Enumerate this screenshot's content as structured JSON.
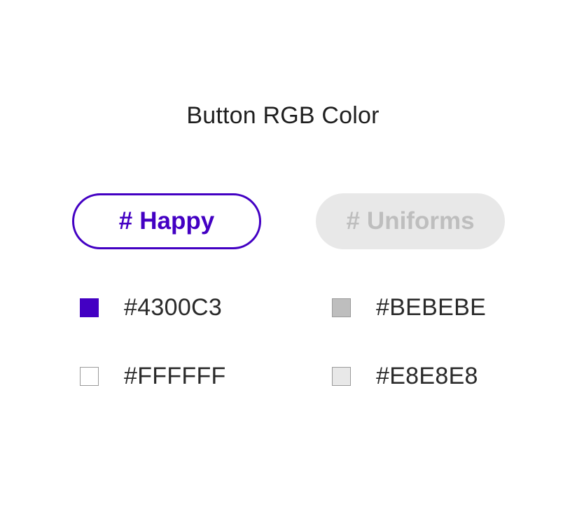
{
  "title": "Button RGB Color",
  "buttons": {
    "happy": {
      "hash": "#",
      "label": "Happy",
      "border_color": "#4300C3",
      "text_color": "#4300C3",
      "bg_color": "#FFFFFF"
    },
    "uniforms": {
      "hash": "#",
      "label": "Uniforms",
      "text_color": "#BEBEBE",
      "bg_color": "#E8E8E8"
    }
  },
  "swatches": [
    {
      "label": "#4300C3",
      "color": "#4300C3"
    },
    {
      "label": "#BEBEBE",
      "color": "#BEBEBE"
    },
    {
      "label": "#FFFFFF",
      "color": "#FFFFFF"
    },
    {
      "label": "#E8E8E8",
      "color": "#E8E8E8"
    }
  ]
}
